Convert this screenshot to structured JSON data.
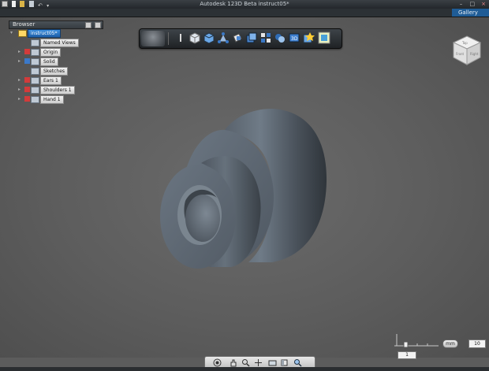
{
  "app": {
    "title": "Autodesk 123D Beta  instruct05*",
    "gallery_label": "Gallery"
  },
  "quick_access": [
    "app-menu-icon",
    "new-icon",
    "open-icon",
    "save-icon",
    "undo-icon",
    "redo-icon"
  ],
  "window_controls": {
    "minimize": "–",
    "restore": "□",
    "close": "×"
  },
  "browser": {
    "title": "Browser",
    "tree": [
      {
        "label": "instruct05*",
        "icon": "component-icon",
        "level": 0,
        "selected": true
      },
      {
        "label": "Named Views",
        "icon": "folder-icon",
        "level": 1
      },
      {
        "label": "Origin",
        "icon": "folder-icon",
        "level": 1
      },
      {
        "label": "Solid",
        "icon": "folder-icon",
        "level": 1
      },
      {
        "label": "Sketches",
        "icon": "folder-icon",
        "level": 1
      },
      {
        "label": "Ears 1",
        "icon": "folder-icon",
        "level": 1
      },
      {
        "label": "Shoulders 1",
        "icon": "folder-icon",
        "level": 1
      },
      {
        "label": "Hand 1",
        "icon": "folder-icon",
        "level": 1
      }
    ]
  },
  "toolbar": {
    "items": [
      "home-view-icon",
      "info-icon",
      "primitives-icon",
      "sketch-icon",
      "construct-icon",
      "modify-icon",
      "pattern-icon",
      "grouping-icon",
      "combine-icon",
      "3d-print-icon",
      "materials-icon",
      "snap-icon"
    ]
  },
  "viewcube": {
    "faces": [
      "Top",
      "Front",
      "Right"
    ]
  },
  "units": {
    "unit": "mm",
    "grid_value": "10",
    "scale_value": "1"
  },
  "navbar": {
    "items": [
      "orbit-icon",
      "pan-icon",
      "zoom-icon",
      "look-at-icon",
      "display-mode-icon",
      "visual-style-icon",
      "zoom-fit-icon"
    ]
  }
}
